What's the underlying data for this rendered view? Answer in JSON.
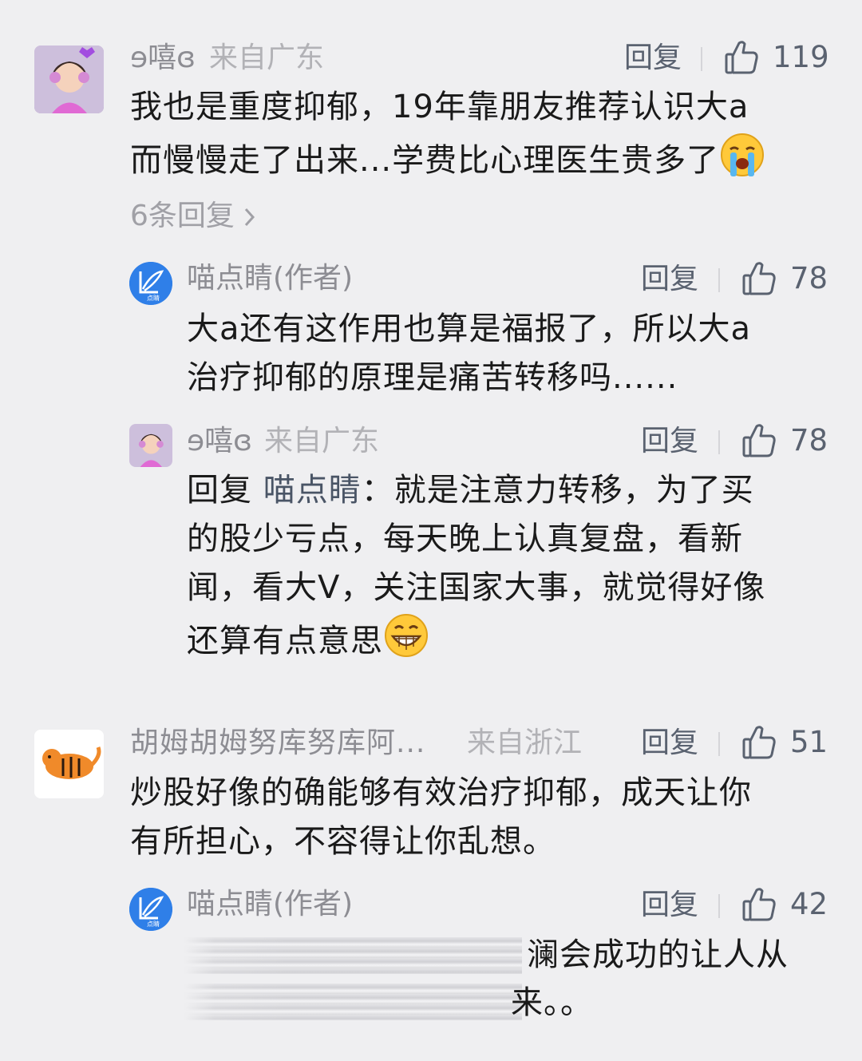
{
  "comments": [
    {
      "user": "ɘ嘻ɞ",
      "location": "来自广东",
      "reply_label": "回复",
      "likes": "119",
      "text_line1": "我也是重度抑郁，19年靠朋友推荐认识大a",
      "text_line2": "而慢慢走了出来...学费比心理医生贵多了",
      "emoji": "crying-face",
      "more_replies": "6条回复",
      "replies": [
        {
          "user": "喵点睛(作者)",
          "reply_label": "回复",
          "likes": "78",
          "text_line1": "大a还有这作用也算是福报了，所以大a",
          "text_line2": "治疗抑郁的原理是痛苦转移吗......"
        },
        {
          "user": "ɘ嘻ɞ",
          "location": "来自广东",
          "reply_label": "回复",
          "likes": "78",
          "reply_prefix": "回复",
          "reply_to": "喵点睛",
          "text_line1_rest": "：就是注意力转移，为了买",
          "text_line2": "的股少亏点，每天晚上认真复盘，看新",
          "text_line3": "闻，看大V，关注国家大事，就觉得好像",
          "text_line4": "还算有点意思",
          "emoji": "grinning-face"
        }
      ]
    },
    {
      "user": "胡姆胡姆努库努库阿...",
      "location": "来自浙江",
      "reply_label": "回复",
      "likes": "51",
      "text_line1": "炒股好像的确能够有效治疗抑郁，成天让你",
      "text_line2": "有所担心，不容得让你乱想。",
      "replies": [
        {
          "user": "喵点睛(作者)",
          "reply_label": "回复",
          "likes": "42",
          "text_line1_visible": "澜会成功的让人从",
          "text_line2_visible": "来。。"
        }
      ]
    }
  ],
  "colors": {
    "background": "#efeff1",
    "name_gray": "#8d8d93",
    "location_gray": "#b2b2b6",
    "action_gray": "#5a6270",
    "avatar_blue": "#2f7fe8"
  }
}
